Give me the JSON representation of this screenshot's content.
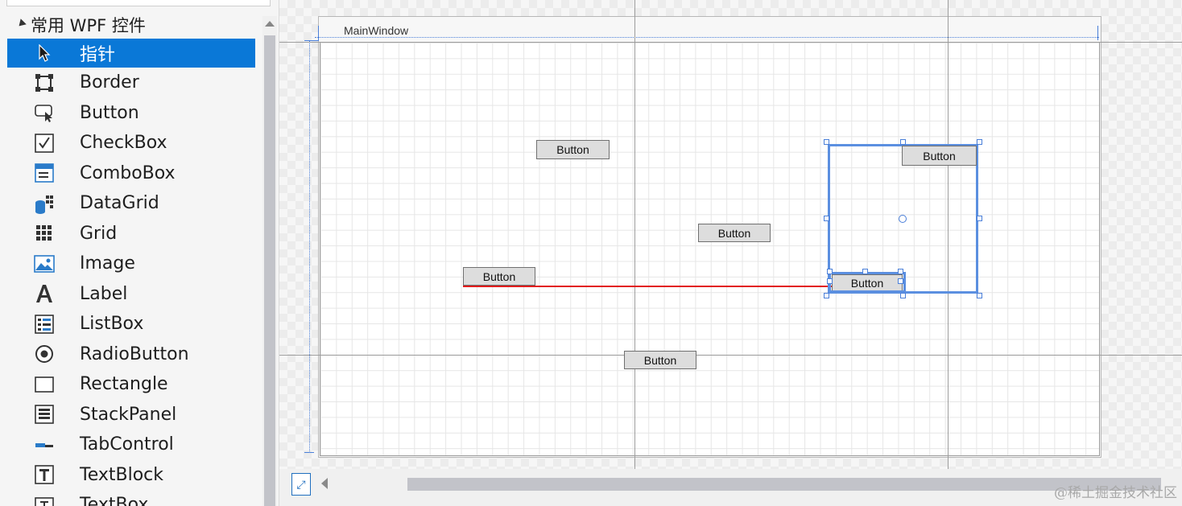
{
  "toolbox": {
    "group_title": "常用 WPF 控件",
    "items": [
      {
        "label": "指针",
        "icon": "pointer-icon",
        "selected": true
      },
      {
        "label": "Border",
        "icon": "border-icon"
      },
      {
        "label": "Button",
        "icon": "button-icon"
      },
      {
        "label": "CheckBox",
        "icon": "checkbox-icon"
      },
      {
        "label": "ComboBox",
        "icon": "combobox-icon"
      },
      {
        "label": "DataGrid",
        "icon": "datagrid-icon"
      },
      {
        "label": "Grid",
        "icon": "grid-icon"
      },
      {
        "label": "Image",
        "icon": "image-icon"
      },
      {
        "label": "Label",
        "icon": "label-icon"
      },
      {
        "label": "ListBox",
        "icon": "listbox-icon"
      },
      {
        "label": "RadioButton",
        "icon": "radiobutton-icon"
      },
      {
        "label": "Rectangle",
        "icon": "rectangle-icon"
      },
      {
        "label": "StackPanel",
        "icon": "stackpanel-icon"
      },
      {
        "label": "TabControl",
        "icon": "tabcontrol-icon"
      },
      {
        "label": "TextBlock",
        "icon": "textblock-icon"
      },
      {
        "label": "TextBox",
        "icon": "textbox-icon"
      }
    ]
  },
  "designer": {
    "window_title": "MainWindow",
    "buttons": {
      "b1": "Button",
      "b2": "Button",
      "b3": "Button",
      "b4": "Button",
      "b5": "Button",
      "b6": "Button"
    },
    "selected_inner_button": "Button",
    "colors": {
      "selection": "#5b8fe0",
      "alignment_guide": "#e21b1b",
      "toolbox_selected": "#0a78d7"
    }
  },
  "watermark": "@稀土掘金技术社区"
}
